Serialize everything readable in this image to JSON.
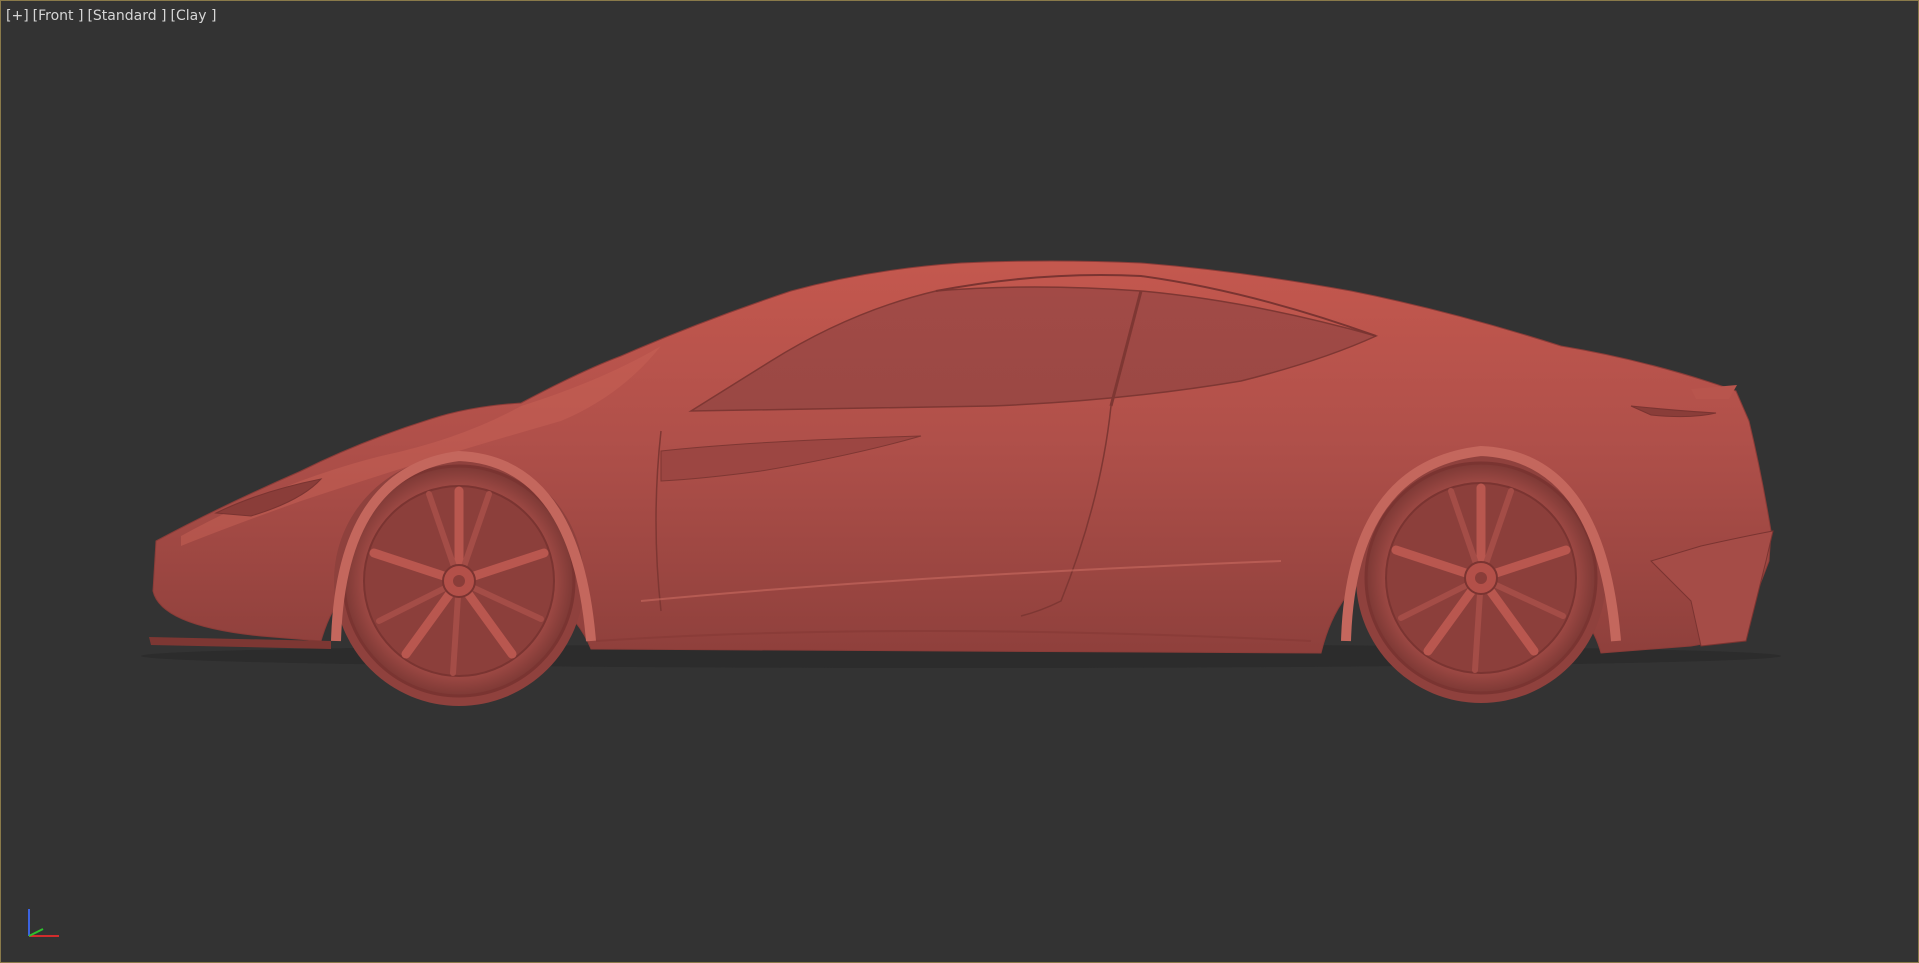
{
  "viewport": {
    "labels": [
      {
        "name": "viewport-menu-plus",
        "text": "[+]"
      },
      {
        "name": "viewport-menu-view",
        "text": "[Front ]"
      },
      {
        "name": "viewport-menu-camera",
        "text": "[Standard ]"
      },
      {
        "name": "viewport-menu-shading",
        "text": "[Clay ]"
      }
    ]
  },
  "scene": {
    "object": "car-clay-model",
    "colors": {
      "background": "#333333",
      "clay": "#b5514a",
      "clay_light": "#c96a60",
      "clay_dark": "#8a3e3a",
      "border": "#8a7a4a"
    }
  },
  "gizmo": {
    "axes": [
      "x",
      "y",
      "z"
    ],
    "colors": {
      "x": "#d22c2c",
      "y": "#2cc22c",
      "z": "#3b63e0"
    }
  }
}
